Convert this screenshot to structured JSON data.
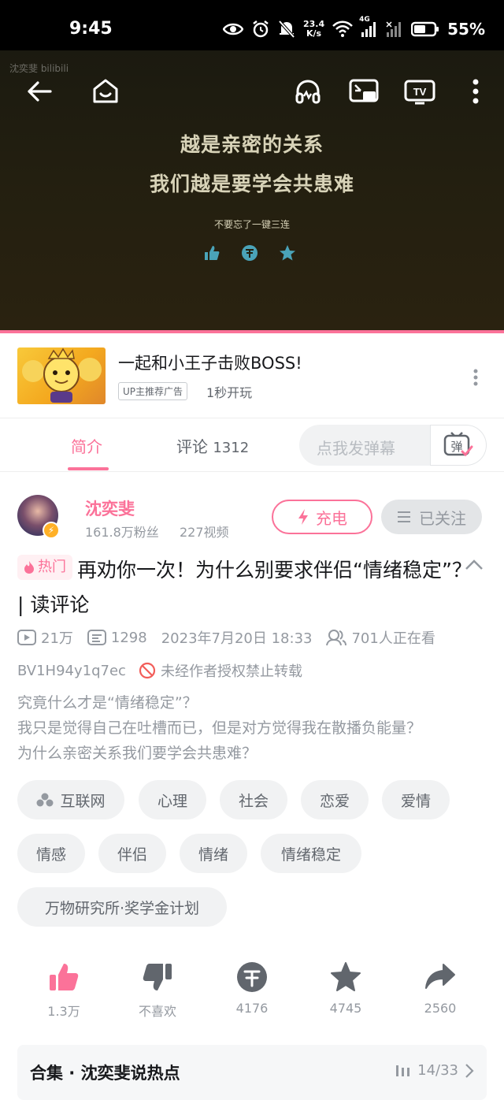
{
  "status_bar": {
    "time": "9:45",
    "net_speed_value": "23.4",
    "net_speed_unit": "K/s",
    "network_type": "4G",
    "battery": "55%"
  },
  "video": {
    "watermark": "沈奕斐 bilibili",
    "line1": "越是亲密的关系",
    "line2": "我们越是要学会共患难",
    "line3": "不要忘了一键三连"
  },
  "ad": {
    "title": "一起和小王子击败BOSS!",
    "tag": "UP主推荐广告",
    "subtitle": "1秒开玩"
  },
  "tabs": {
    "intro": "简介",
    "comments": "评论",
    "comments_count": "1312",
    "danmu_placeholder": "点我发弹幕",
    "danmu_button": "弹"
  },
  "uploader": {
    "name": "沈奕斐",
    "followers": "161.8万粉丝",
    "videos": "227视频",
    "charge_label": "充电",
    "follow_label": "已关注"
  },
  "video_info": {
    "hot_label": "热门",
    "title": "再劝你一次！为什么别要求伴侣“情绪稳定”？ | 读评论",
    "views": "21万",
    "danmaku": "1298",
    "date": "2023年7月20日 18:33",
    "watching": "701人正在看",
    "bvid": "BV1H94y1q7ec",
    "no_repost": "未经作者授权禁止转载",
    "description_lines": [
      "究竟什么才是“情绪稳定”？",
      "我只是觉得自己在吐槽而已，但是对方觉得我在散播负能量？",
      "为什么亲密关系我们要学会共患难？"
    ]
  },
  "tags": [
    "互联网",
    "心理",
    "社会",
    "恋爱",
    "爱情",
    "情感",
    "伴侣",
    "情绪",
    "情绪稳定",
    "万物研究所·奖学金计划"
  ],
  "actions": {
    "like": "1.3万",
    "dislike": "不喜欢",
    "coin": "4176",
    "favorite": "4745",
    "share": "2560"
  },
  "collection": {
    "title": "合集 · 沈奕斐说热点",
    "progress": "14/33"
  },
  "colors": {
    "accent": "#fb7299",
    "gray_text": "#9499a0",
    "tag_bg": "#f1f2f3",
    "video_text": "#d8d3b8",
    "video_icon": "#4aa3b8"
  }
}
